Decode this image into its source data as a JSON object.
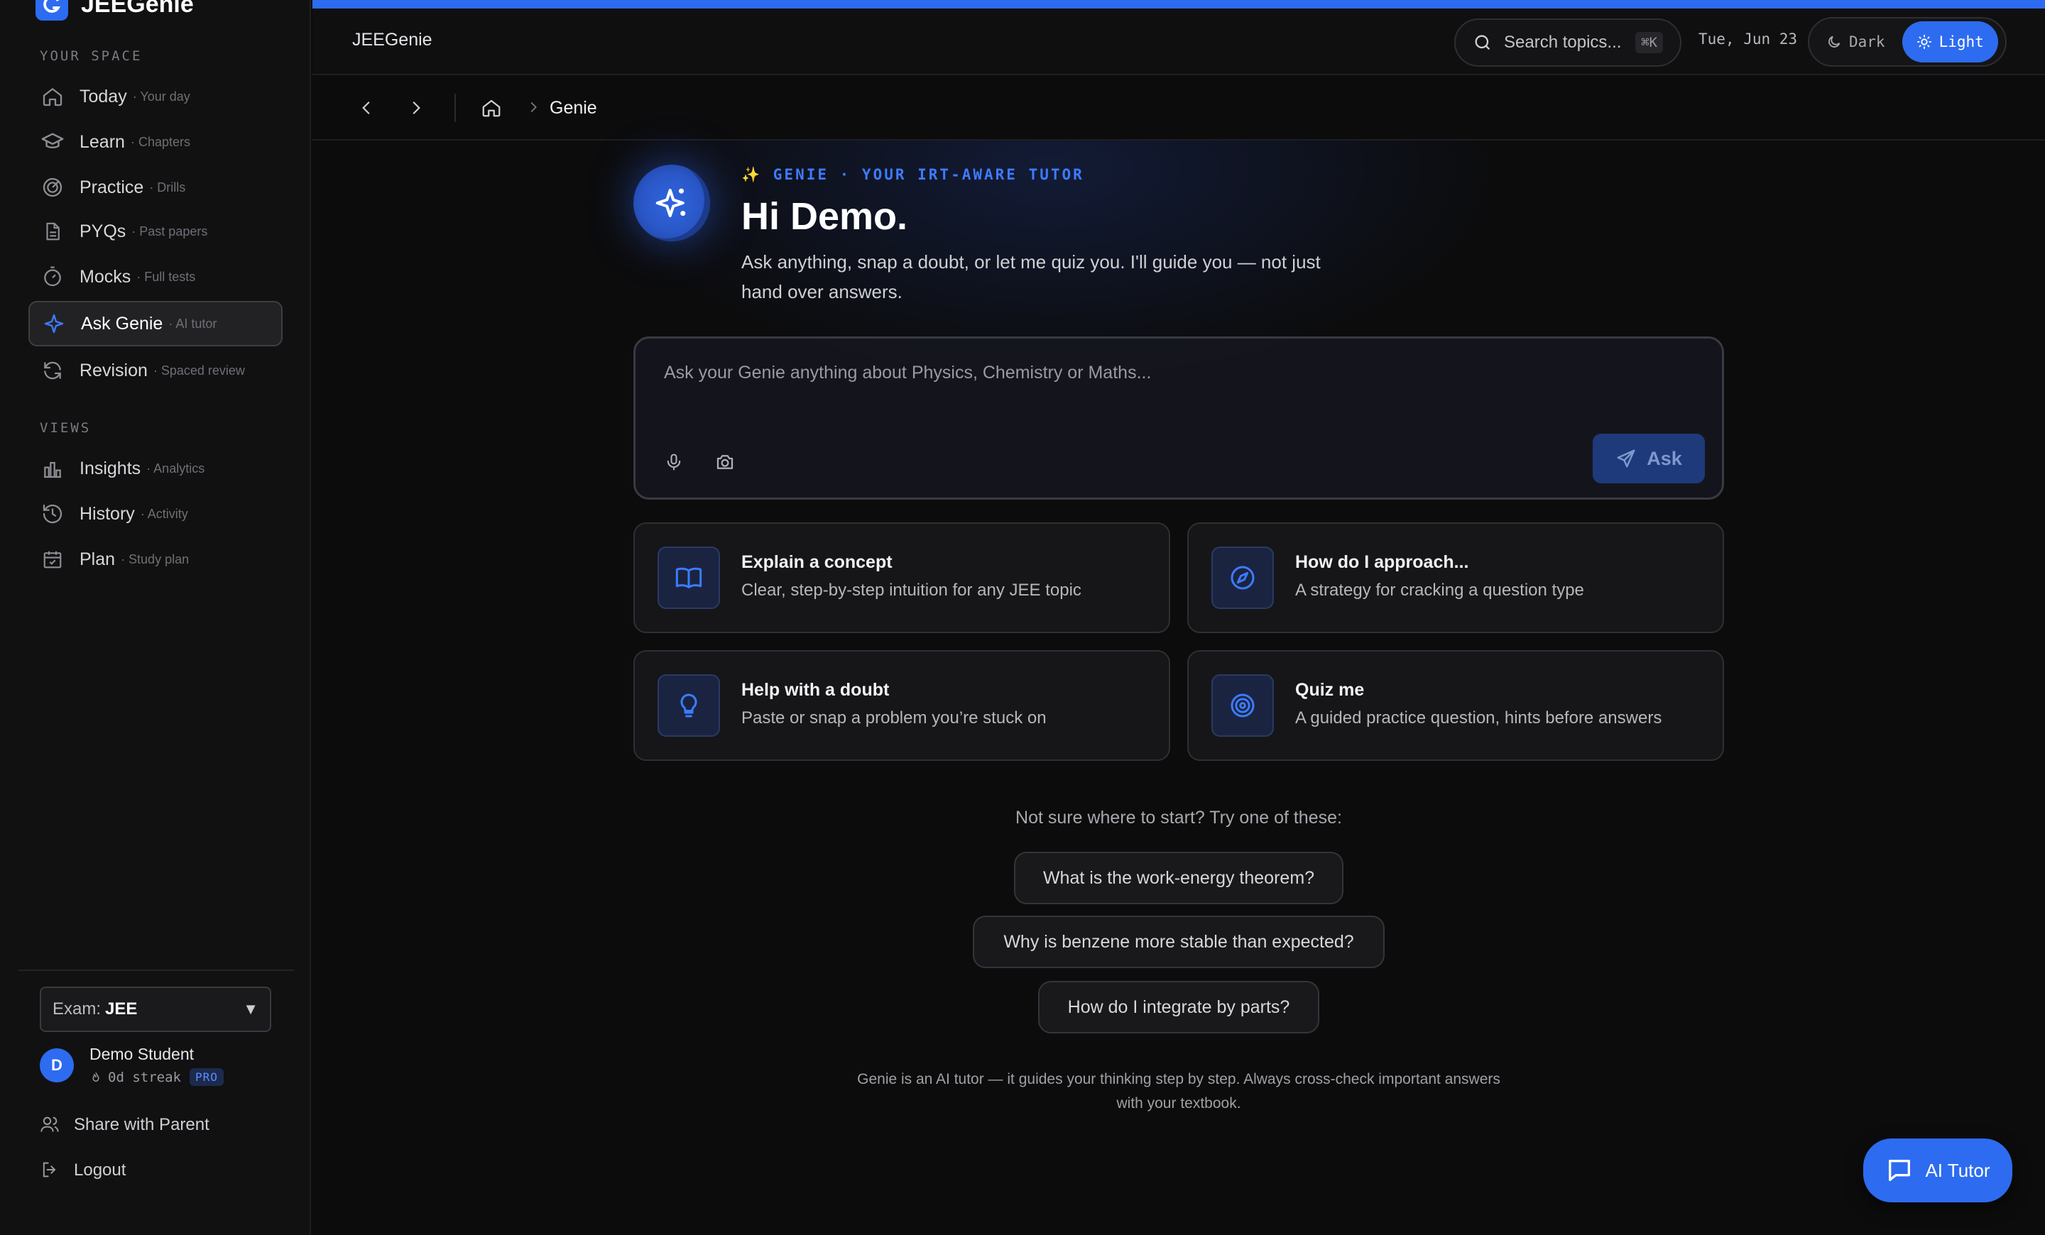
{
  "brand": {
    "name": "JEEGenie"
  },
  "sidebar": {
    "section_space": "YOUR SPACE",
    "section_views": "VIEWS",
    "items": [
      {
        "label": "Today",
        "sub": "· Your day",
        "icon": "home-icon"
      },
      {
        "label": "Learn",
        "sub": "· Chapters",
        "icon": "graduation-cap-icon"
      },
      {
        "label": "Practice",
        "sub": "· Drills",
        "icon": "target-icon"
      },
      {
        "label": "PYQs",
        "sub": "· Past papers",
        "icon": "document-icon"
      },
      {
        "label": "Mocks",
        "sub": "· Full tests",
        "icon": "stopwatch-icon"
      },
      {
        "label": "Ask Genie",
        "sub": "· AI tutor",
        "icon": "sparkle-icon",
        "active": true
      },
      {
        "label": "Revision",
        "sub": "· Spaced review",
        "icon": "refresh-icon"
      }
    ],
    "views": [
      {
        "label": "Insights",
        "sub": "· Analytics",
        "icon": "bar-chart-icon"
      },
      {
        "label": "History",
        "sub": "· Activity",
        "icon": "history-icon"
      },
      {
        "label": "Plan",
        "sub": "· Study plan",
        "icon": "calendar-icon"
      }
    ],
    "exam": {
      "prefix": "Exam:",
      "value": "JEE"
    },
    "user": {
      "initial": "D",
      "name": "Demo Student",
      "streak": "0d streak",
      "badge": "PRO"
    },
    "share": "Share with Parent",
    "logout": "Logout"
  },
  "topbar": {
    "title": "JEEGenie",
    "search_label": "Search topics...",
    "search_kbd": "⌘K",
    "date": "Tue, Jun 23",
    "theme_dark": "Dark",
    "theme_light": "Light",
    "theme_selected": "Light"
  },
  "breadcrumb": {
    "current": "Genie"
  },
  "hero": {
    "eyebrow": "✨ GENIE · YOUR IRT-AWARE TUTOR",
    "title": "Hi Demo.",
    "subtitle": "Ask anything, snap a doubt, or let me quiz you. I'll guide you — not just hand over answers."
  },
  "ask": {
    "placeholder": "Ask your Genie anything about Physics, Chemistry or Maths...",
    "button": "Ask"
  },
  "cards": [
    {
      "title": "Explain a concept",
      "desc": "Clear, step-by-step intuition for any JEE topic",
      "icon": "book-icon"
    },
    {
      "title": "How do I approach...",
      "desc": "A strategy for cracking a question type",
      "icon": "compass-icon"
    },
    {
      "title": "Help with a doubt",
      "desc": "Paste or snap a problem you’re stuck on",
      "icon": "lightbulb-icon"
    },
    {
      "title": "Quiz me",
      "desc": "A guided practice question, hints before answers",
      "icon": "bullseye-icon"
    }
  ],
  "suggestions": {
    "label": "Not sure where to start? Try one of these:",
    "items": [
      "What is the work-energy theorem?",
      "Why is benzene more stable than expected?",
      "How do I integrate by parts?"
    ]
  },
  "disclaimer": "Genie is an AI tutor — it guides your thinking step by step. Always cross-check important answers with your textbook.",
  "fab": {
    "label": "AI Tutor"
  },
  "colors": {
    "accent": "#2d6cf0",
    "background": "#0c0c0d",
    "sidebar": "#111112"
  }
}
